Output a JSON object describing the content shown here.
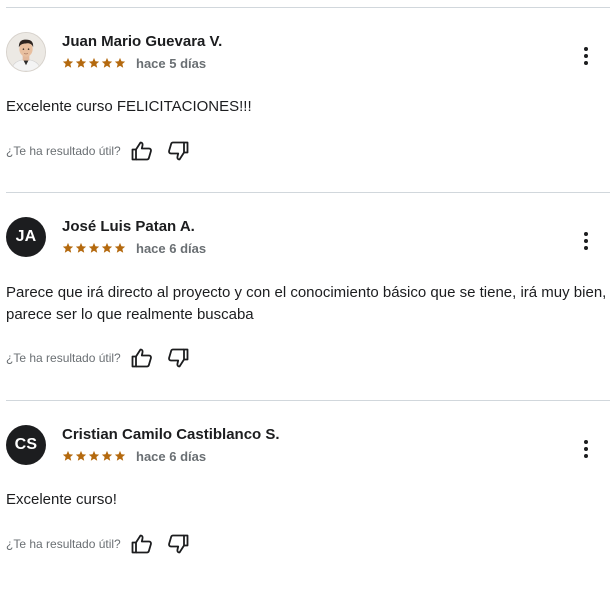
{
  "helpful_label": "¿Te ha resultado útil?",
  "colors": {
    "star": "#b4690e",
    "text": "#1c1d1f",
    "muted": "#6a6f73",
    "divider": "#d1d7dc",
    "avatar_bg": "#1c1d1f"
  },
  "icons": {
    "more": "vertical-dots-icon",
    "thumbs_up": "thumbs-up-icon",
    "thumbs_down": "thumbs-down-icon",
    "star": "star-icon"
  },
  "reviews": [
    {
      "name": "Juan Mario Guevara V.",
      "avatar_type": "photo",
      "initials": "",
      "rating": 5,
      "date": "hace 5 días",
      "text": "Excelente curso FELICITACIONES!!!"
    },
    {
      "name": "José Luis Patan A.",
      "avatar_type": "initials",
      "initials": "JA",
      "rating": 5,
      "date": "hace 6 días",
      "text": "Parece que irá directo al proyecto y con el conocimiento básico que se tiene, irá muy bien, parece ser lo que realmente buscaba"
    },
    {
      "name": "Cristian Camilo Castiblanco S.",
      "avatar_type": "initials",
      "initials": "CS",
      "rating": 5,
      "date": "hace 6 días",
      "text": "Excelente curso!"
    }
  ]
}
